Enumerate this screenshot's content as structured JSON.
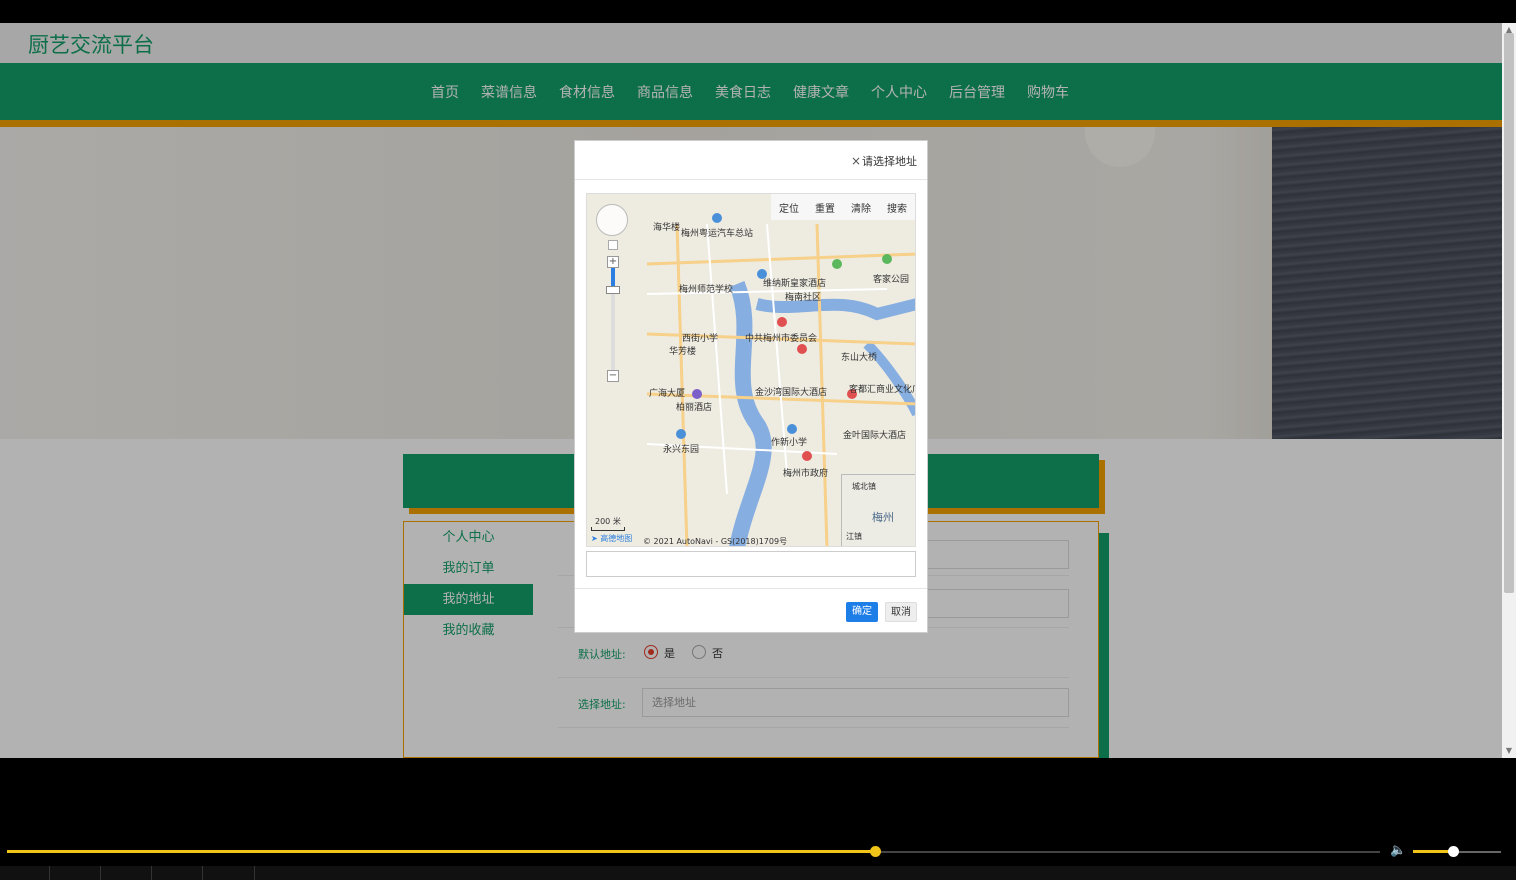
{
  "site": {
    "brand": "厨艺交流平台"
  },
  "nav": {
    "items": [
      "首页",
      "菜谱信息",
      "食材信息",
      "商品信息",
      "美食日志",
      "健康文章",
      "个人中心",
      "后台管理",
      "购物车"
    ]
  },
  "sidebar": {
    "items": [
      {
        "label": "个人中心",
        "active": false
      },
      {
        "label": "我的订单",
        "active": false
      },
      {
        "label": "我的地址",
        "active": true
      },
      {
        "label": "我的收藏",
        "active": false
      }
    ]
  },
  "form": {
    "default_label": "默认地址:",
    "default_yes": "是",
    "default_no": "否",
    "default_value": "是",
    "select_label": "选择地址:",
    "select_placeholder": "选择地址"
  },
  "modal": {
    "close_icon": "×",
    "title": "请选择地址",
    "toolbar": [
      "定位",
      "重置",
      "清除",
      "搜索"
    ],
    "map_labels": [
      "梅州粤运汽车总站",
      "梅州师范学校",
      "维纳斯皇家酒店",
      "梅南社区",
      "客家公园",
      "中共梅州市委员会",
      "西街小学",
      "东山大桥",
      "金沙湾国际大酒店",
      "客都汇商业文化广场",
      "柏丽酒店",
      "作新小学",
      "金叶国际大酒店",
      "永兴东园",
      "梅州市政府",
      "广海大厦",
      "华芳楼",
      "海华楼"
    ],
    "scale": "200 米",
    "copyright": "© 2021 AutoNavi - GS(2018)1709号",
    "logo": "高德地图",
    "overview_labels": [
      "梅州",
      "城北镇",
      "江镇"
    ],
    "ok_label": "确定",
    "cancel_label": "取消"
  },
  "player": {
    "progress": 0.632,
    "volume": 0.45
  },
  "colors": {
    "brand_green": "#14a06a",
    "accent_orange": "#f4a300",
    "ok_blue": "#1e7ee8",
    "progress_yellow": "#f0c419"
  }
}
